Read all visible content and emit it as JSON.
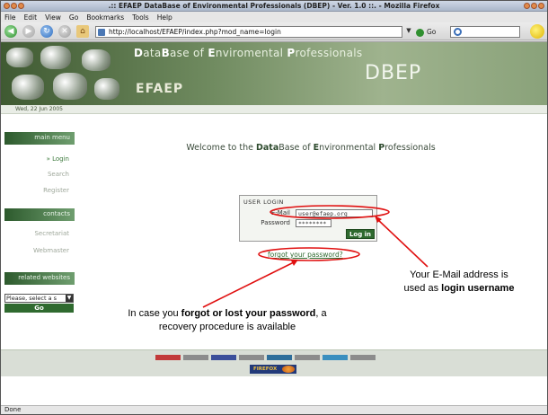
{
  "window": {
    "title": ".:: EFAEP DataBase of Environmental Professionals (DBEP) - Ver. 1.0 ::. - Mozilla Firefox"
  },
  "menubar": {
    "items": [
      "File",
      "Edit",
      "View",
      "Go",
      "Bookmarks",
      "Tools",
      "Help"
    ]
  },
  "navbar": {
    "url": "http://localhost/EFAEP/index.php?mod_name=login",
    "go_label": "Go",
    "icons": [
      "back-icon",
      "forward-icon",
      "reload-icon",
      "stop-icon",
      "home-icon"
    ]
  },
  "site": {
    "tagline_parts": [
      "D",
      "ata",
      "B",
      "ase of ",
      "E",
      "nviromental ",
      "P",
      "rofessionals"
    ],
    "logo_efaep": "EFAEP",
    "logo_dbep": "DBEP",
    "date": "Wed, 22 Jun 2005"
  },
  "sidebar": {
    "main_menu_title": "main menu",
    "main_menu_items": [
      "» Login",
      "Search",
      "Register"
    ],
    "contacts_title": "contacts",
    "contacts_items": [
      "Secretariat",
      "Webmaster"
    ],
    "related_title": "related websites",
    "related_select_value": "Please, select a s",
    "related_go": "Go"
  },
  "main": {
    "welcome_prefix": "Welcome to the ",
    "welcome_bold1": "Data",
    "welcome_bold2": "Base",
    "welcome_mid": " of ",
    "welcome_bold3": "E",
    "welcome_rest1": "nvironmental ",
    "welcome_bold4": "P",
    "welcome_rest2": "rofessionals",
    "login_title": "USER LOGIN",
    "email_label": "E-Mail",
    "email_value": "user@efaep.org",
    "password_label": "Password",
    "password_value": "********",
    "login_button": "Log in",
    "forgot_link": "forgot your password?"
  },
  "annotations": {
    "email_note_line1": "Your E-Mail address is",
    "email_note_line2_plain": "used as ",
    "email_note_line2_bold": "login username",
    "forgot_note_line1_plain": "In case you ",
    "forgot_note_line1_bold": "forgot or lost your password",
    "forgot_note_line1_tail": ", a",
    "forgot_note_line2": "recovery procedure is available",
    "accent_color": "#e01010"
  },
  "footer": {
    "firefox_badge": "FIREFOX"
  },
  "status": {
    "text": "Done"
  }
}
